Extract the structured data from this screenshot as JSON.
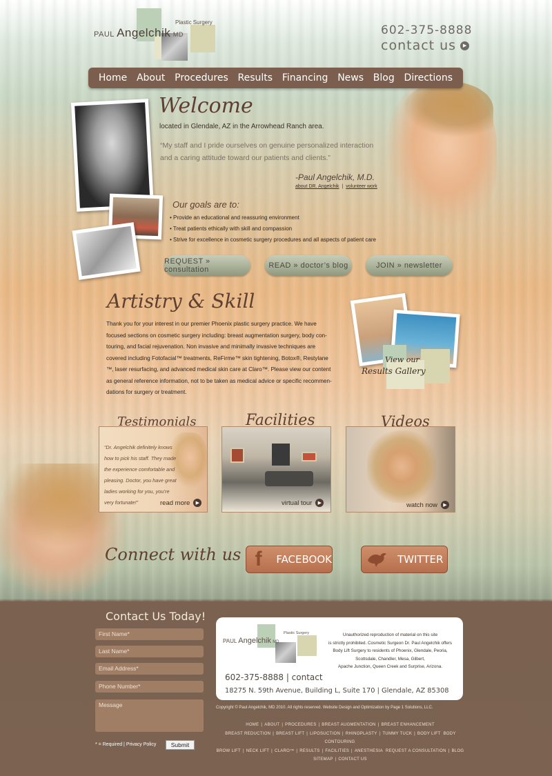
{
  "header": {
    "logo_first": "PAUL",
    "logo_last": "Angelchik",
    "logo_suffix": "MD",
    "logo_tag": "Plastic Surgery",
    "phone": "602-375-8888",
    "contact_label": "contact us"
  },
  "nav": {
    "items": [
      "Home",
      "About",
      "Procedures",
      "Results",
      "Financing",
      "News",
      "Blog",
      "Directions"
    ]
  },
  "welcome": {
    "title": "Welcome",
    "location": "located in Glendale, AZ in the Arrowhead Ranch area.",
    "quote_line1": "“My staff and I pride ourselves on genuine personalized interaction",
    "quote_line2": "and a caring attitude toward our patients and clients.”",
    "signature": "-Paul Angelchik, M.D.",
    "link_about": "about DR. Angelchik",
    "link_volunteer": "volunteer work"
  },
  "goals": {
    "title": "Our goals are to:",
    "items": [
      "• Provide an educational and reassuring environment",
      "• Treat patients ethically with skill and compassion",
      "• Strive for excellence in cosmetic surgery procedures and all aspects of patient care"
    ]
  },
  "actions": {
    "request": "REQUEST » consultation",
    "read": "READ » doctor’s blog",
    "join": "JOIN » newsletter"
  },
  "artistry": {
    "title": "Artistry & Skill",
    "lines": [
      "Thank you for your interest in our premier Phoenix plastic surgery practice. We have",
      "focused sections on cosmetic surgery including: breast augmentation surgery, body con-",
      "touring, and facial rejuvenation. Non invasive and minimally invasive techniques are",
      "covered including Fotofacial™ treatments, ReFirme™ skin tightening, Botox®, Restylane",
      "™, laser resurfacing, and advanced medical skin care at Claro™. Please view our content",
      "as general reference information, not to be taken as medical advice or specific recommen-",
      "dations for surgery or treatment."
    ],
    "gallery_line1": "View our",
    "gallery_line2": "Results Gallery"
  },
  "cards": {
    "testimonials": {
      "title": "Testimonials",
      "quote_lines": [
        "“Dr. Angelchik definitely knows",
        "how to pick his staff. They made",
        "the experience comfortable and",
        "pleasing. Doctor, you have great",
        "ladies working for you, you’re",
        "very fortunate!”"
      ],
      "more": "read more"
    },
    "facilities": {
      "title": "Facilities",
      "more": "virtual tour"
    },
    "videos": {
      "title": "Videos",
      "more": "watch now"
    }
  },
  "connect": {
    "title": "Connect with us",
    "facebook": "FACEBOOK",
    "twitter": "TWITTER"
  },
  "footer": {
    "contact_title": "Contact Us Today!",
    "first_name": "First Name*",
    "last_name": "Last Name*",
    "email": "Email Address*",
    "phone": "Phone Number*",
    "message": "Message",
    "required_note": "* = Required | Privacy Policy",
    "submit": "Submit",
    "notice_lines": [
      "Unauthorized reproduction of material on this site",
      "is strictly prohibited. Cosmetic Surgeon Dr. Paul Angelchik offers",
      "Body Lift Surgery to residents of Phoenix, Glendale, Peoria,",
      "Scottsdale, Chandler, Mesa, Gilbert,",
      "Apache Junction, Queen Creek and Surprise, Arizona."
    ],
    "phone_contact": "602-375-8888 | contact",
    "address": "18275 N. 59th Avenue, Building L, Suite 170 | Glendale, AZ  85308",
    "copyright": "Copyright © Paul Angelchik, MD 2010. All rights reserved. Website Design and Optimization by Page 1 Solutions, LLC.",
    "link_rows": [
      [
        "HOME",
        "ABOUT",
        "PROCEDURES",
        "BREAST AUGMENTATION",
        "BREAST ENHANCEMENT"
      ],
      [
        "BREAST REDUCTION",
        "BREAST LIFT",
        "LIPOSUCTION",
        "RHINOPLASTY",
        "TUMMY TUCK",
        "BODY LIFT",
        "BODY CONTOURING"
      ],
      [
        "BROW LIFT",
        "NECK LIFT",
        "CLARO™",
        "RESULTS",
        "FACILITIES",
        "ANESTHESIA",
        "REQUEST A CONSULTATION",
        "BLOG"
      ],
      [
        "SITEMAP",
        "CONTACT US"
      ]
    ]
  },
  "colors": {
    "brown": "#7b5e4d",
    "script": "#5e3f31",
    "logo_sage": "#bcd0b8",
    "logo_tan": "#d8d6b0"
  }
}
